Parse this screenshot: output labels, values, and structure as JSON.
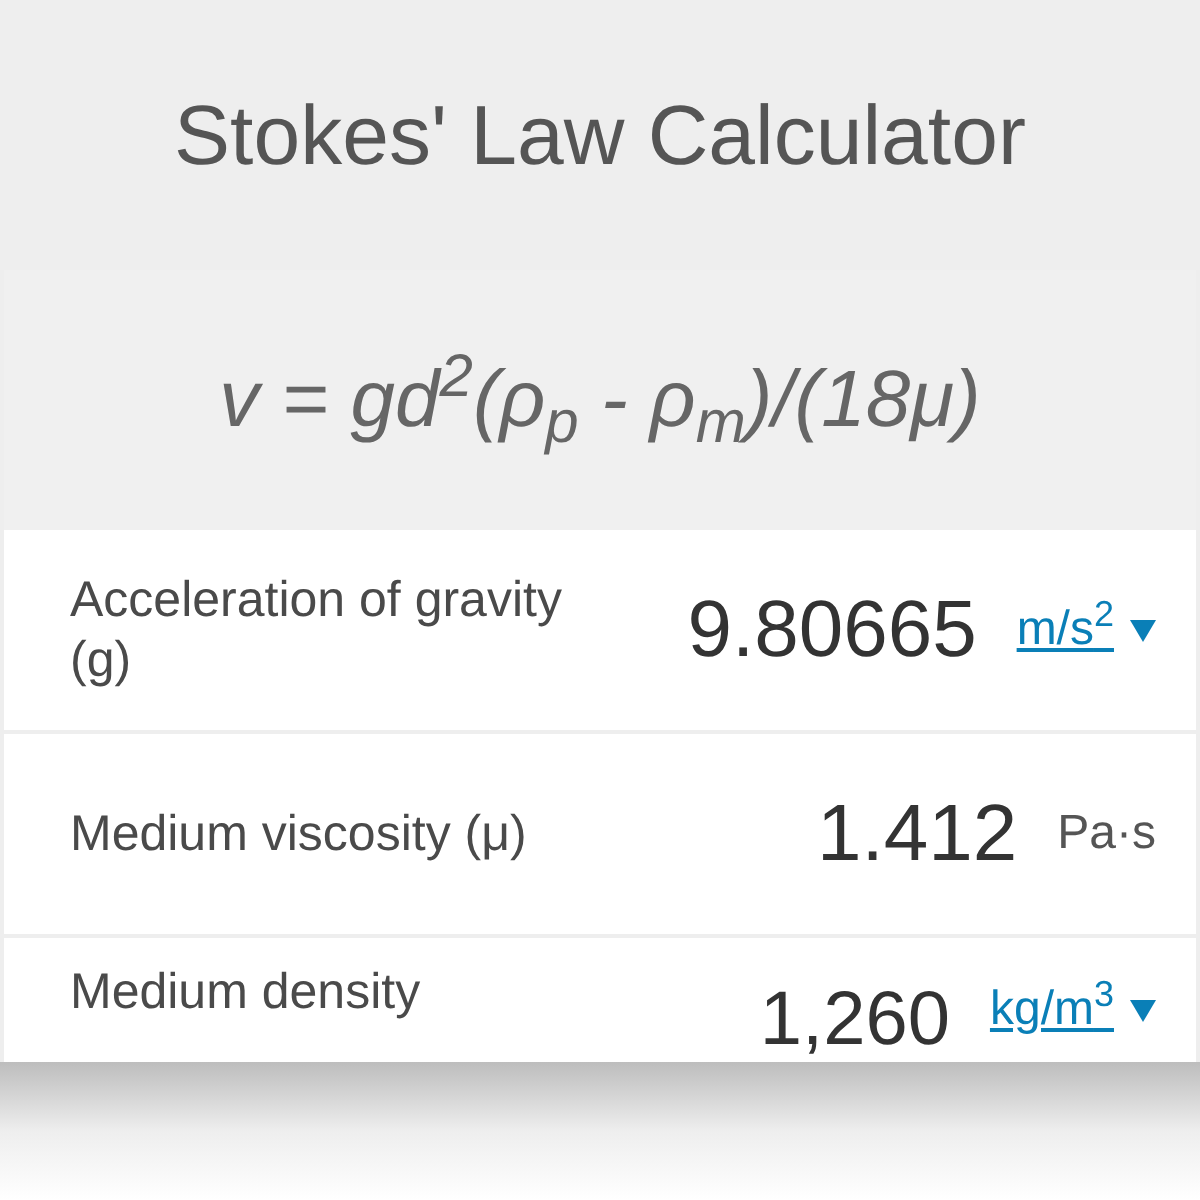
{
  "title": "Stokes' Law Calculator",
  "formula": "v = gd$^{2}$(ρ$_{p}$ - ρ$_{m}$)/(18μ)",
  "rows": [
    {
      "label": "Acceleration of gravity (g)",
      "value": "9.80665",
      "unit": "m/s$^{2}$",
      "kind": "dropdown"
    },
    {
      "label": "Medium viscosity (μ)",
      "value": "1.412",
      "unit": "Pa·s",
      "kind": "fixed"
    },
    {
      "label": "Medium density",
      "value": "1,260",
      "unit": "kg/m$^{3}$",
      "kind": "dropdown"
    }
  ]
}
